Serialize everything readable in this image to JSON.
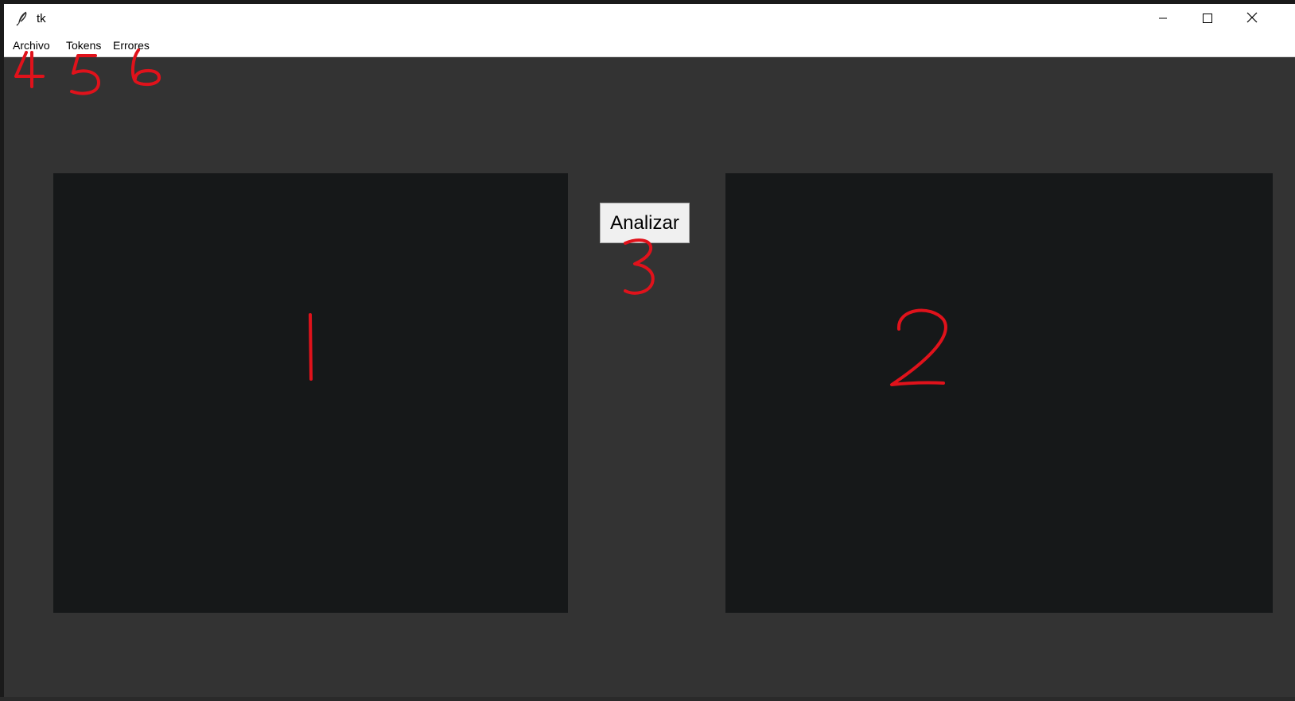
{
  "window": {
    "title": "tk",
    "controls": [
      "minimize",
      "maximize",
      "close"
    ]
  },
  "menu": {
    "items": [
      {
        "label": "Archivo"
      },
      {
        "label": "Tokens"
      },
      {
        "label": "Errores"
      }
    ]
  },
  "main": {
    "analyze_label": "Analizar"
  },
  "annotations": {
    "marks": [
      "1",
      "2",
      "3",
      "4",
      "5",
      "6"
    ],
    "color": "#e0121b"
  },
  "colors": {
    "window_bg": "#333333",
    "panel_bg": "#161819",
    "button_bg": "#f0f0f0"
  }
}
